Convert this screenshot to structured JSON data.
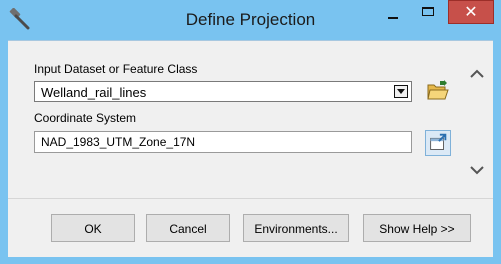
{
  "window": {
    "title": "Define Projection",
    "close_glyph": "✕"
  },
  "form": {
    "dataset_label": "Input Dataset or Feature Class",
    "dataset_value": "Welland_rail_lines",
    "coordinate_label": "Coordinate System",
    "coordinate_value": "NAD_1983_UTM_Zone_17N"
  },
  "buttons": {
    "ok": "OK",
    "cancel": "Cancel",
    "environments": "Environments...",
    "show_help": "Show Help >>"
  },
  "icons": {
    "app": "hammer-icon",
    "browse": "folder-open-icon",
    "coordinate_properties": "coordinate-properties-icon",
    "scroll_up": "chevron-up-icon",
    "scroll_down": "chevron-down-icon"
  },
  "colors": {
    "titlebar": "#79c3f0",
    "close_button": "#c7504a",
    "dialog_background": "#f0f0f0"
  }
}
